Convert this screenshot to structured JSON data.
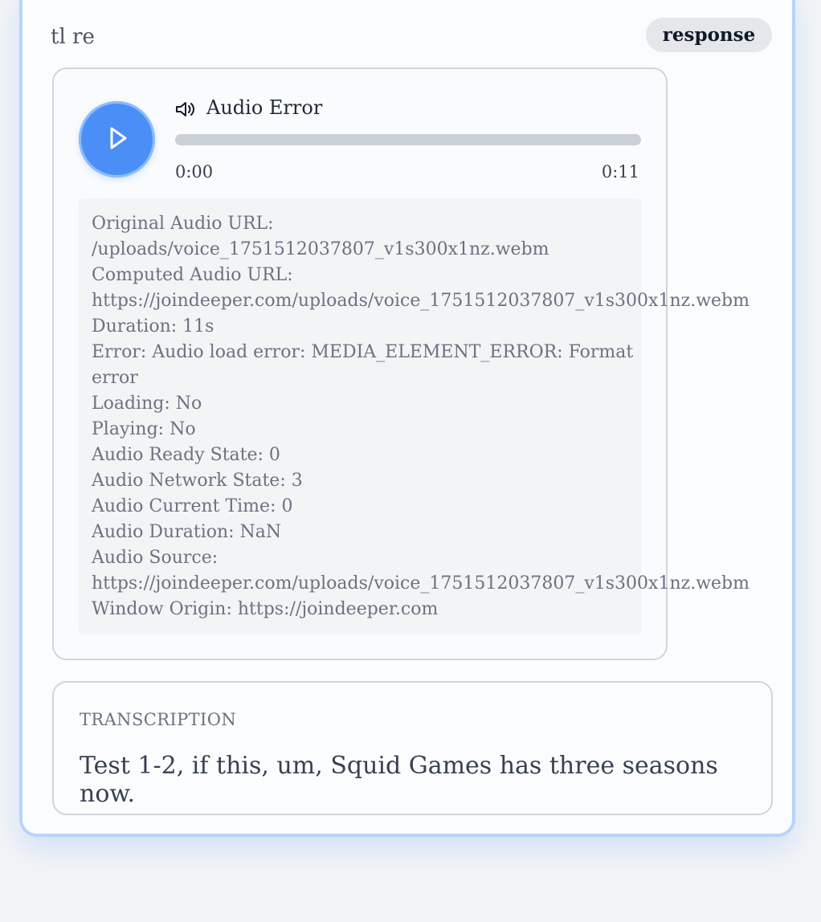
{
  "message": {
    "header": "tl re",
    "badge": "response"
  },
  "audio": {
    "title": "Audio Error",
    "current_time": "0:00",
    "total_time": "0:11",
    "progress": 0
  },
  "debug": {
    "lines": [
      "Original Audio URL:",
      "/uploads/voice_1751512037807_v1s300x1nz.webm",
      "Computed Audio URL:",
      "https://joindeeper.com/uploads/voice_1751512037807_v1s300x1nz.webm",
      "Duration: 11s",
      "Error: Audio load error: MEDIA_ELEMENT_ERROR: Format",
      "error",
      "Loading: No",
      "Playing: No",
      "Audio Ready State: 0",
      "Audio Network State: 3",
      "Audio Current Time: 0",
      "Audio Duration: NaN",
      "Audio Source:",
      "https://joindeeper.com/uploads/voice_1751512037807_v1s300x1nz.webm",
      "Window Origin: https://joindeeper.com"
    ]
  },
  "transcription": {
    "label": "TRANSCRIPTION",
    "text": "Test 1-2, if this, um, Squid Games has three seasons now."
  },
  "icons": {
    "play": "play-icon",
    "speaker": "speaker-icon"
  },
  "colors": {
    "accent": "#4b8ff6",
    "outer_border": "#b7d4fb",
    "debug_background": "#f3f4f6"
  }
}
